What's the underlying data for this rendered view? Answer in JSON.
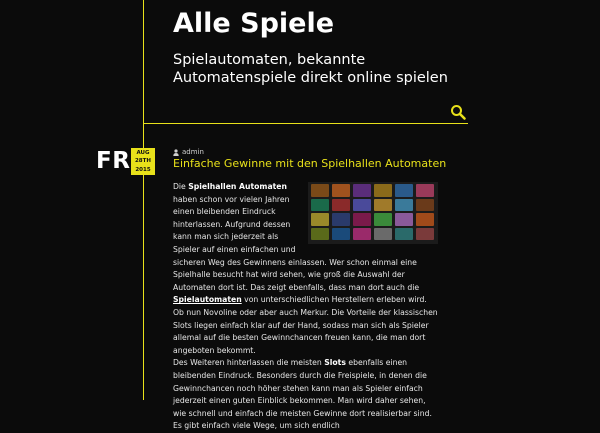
{
  "site": {
    "title": "Alle Spiele",
    "tagline": "Spielautomaten, bekannte Automatenspiele direkt online spielen"
  },
  "icons": {
    "search": "search-icon",
    "author": "user-icon"
  },
  "colors": {
    "background": "#0b0b0b",
    "accent": "#e8e11a",
    "text": "#e6e6e6"
  },
  "post": {
    "day": "FR",
    "date_month": "AUG",
    "date_day": "28TH",
    "date_year": "2015",
    "author": "admin",
    "title": "Einfache Gewinne mit den Spielhallen Automaten",
    "p1_a": "Die ",
    "p1_b": "Spielhallen Automaten",
    "p1_c": " haben schon vor vielen Jahren einen bleibenden Eindruck hinterlassen. Aufgrund dessen kann man sich jederzeit als Spieler auf einen einfachen und sicheren Weg des Gewinnens einlassen. Wer schon einmal eine Spielhalle besucht hat wird sehen, wie groß die Auswahl der Automaten dort ist. Das zeigt ebenfalls, dass man dort auch die ",
    "p1_link": "Spielautomaten",
    "p1_d": " von unterschiedlichen Herstellern erleben wird. Ob nun Novoline oder aber auch Merkur. Die Vorteile der klassischen Slots liegen einfach klar auf der Hand, sodass man sich als Spieler allemal auf die besten Gewinnchancen freuen kann, die man dort angeboten bekommt.",
    "p2_a": "Des Weiteren hinterlassen die meisten ",
    "p2_b": "Slots",
    "p2_c": " ebenfalls einen bleibenden Eindruck. Besonders durch die Freispiele, in denen die Gewinnchancen noch höher stehen kann man als Spieler einfach jederzeit einen guten Einblick bekommen. Man wird daher sehen, wie schnell und einfach die meisten Gewinne dort realisierbar sind. Es gibt einfach viele Wege, um sich endlich"
  }
}
